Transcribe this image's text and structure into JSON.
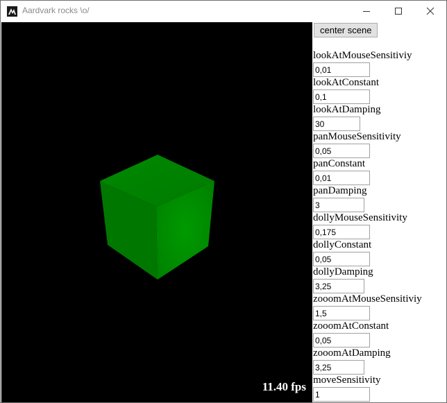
{
  "window": {
    "title": "Aardvark rocks \\o/",
    "fps_text": "11.40 fps",
    "object_color": "#008800"
  },
  "panel": {
    "center_button_label": "center scene",
    "params": [
      {
        "label": "lookAtMouseSensitiviy",
        "value": "0,01"
      },
      {
        "label": "lookAtConstant",
        "value": "0,1"
      },
      {
        "label": "lookAtDamping",
        "value": "30"
      },
      {
        "label": "panMouseSensitivity",
        "value": "0,05"
      },
      {
        "label": "panConstant",
        "value": "0,01"
      },
      {
        "label": "panDamping",
        "value": "3"
      },
      {
        "label": "dollyMouseSensitivity",
        "value": "0,175"
      },
      {
        "label": "dollyConstant",
        "value": "0,05"
      },
      {
        "label": "dollyDamping",
        "value": "3,25"
      },
      {
        "label": "zooomAtMouseSensitiviy",
        "value": "1,5"
      },
      {
        "label": "zooomAtConstant",
        "value": "0,05"
      },
      {
        "label": "zooomAtDamping",
        "value": "3,25"
      },
      {
        "label": "moveSensitivity",
        "value": "1"
      }
    ]
  }
}
